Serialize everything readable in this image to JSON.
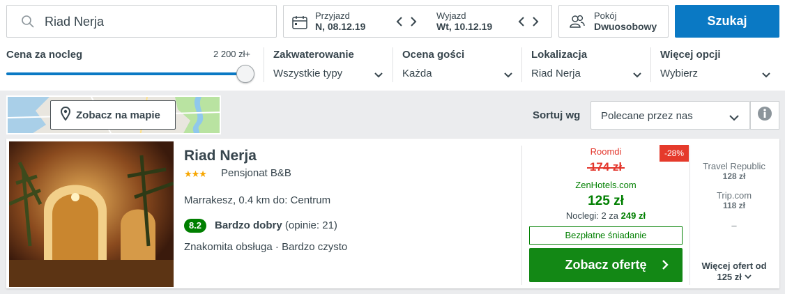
{
  "search": {
    "query": "Riad Nerja"
  },
  "dates": {
    "checkin_label": "Przyjazd",
    "checkin_value": "N, 08.12.19",
    "checkout_label": "Wyjazd",
    "checkout_value": "Wt, 10.12.19"
  },
  "room": {
    "label": "Pokój",
    "value": "Dwuosobowy"
  },
  "search_button": "Szukaj",
  "filters": {
    "price_label": "Cena za nocleg",
    "price_max": "2 200 zł+",
    "price_slider_fraction": 1.0,
    "accommodation_label": "Zakwaterowanie",
    "accommodation_value": "Wszystkie typy",
    "rating_label": "Ocena gości",
    "rating_value": "Każda",
    "location_label": "Lokalizacja",
    "location_value": "Riad Nerja",
    "more_label": "Więcej opcji",
    "more_value": "Wybierz"
  },
  "map_button": "Zobacz na mapie",
  "sort": {
    "label": "Sortuj wg",
    "value": "Polecane przez nas"
  },
  "hotel": {
    "name": "Riad Nerja",
    "stars": 3,
    "stars_text": "★★★",
    "type": "Pensjonat B&B",
    "location": "Marrakesz, 0.4 km do: Centrum",
    "rating_score": "8.2",
    "rating_word": "Bardzo dobry",
    "rating_count": "(opinie: 21)",
    "features": "Znakomita obsługa · Bardzo czysto",
    "deal": {
      "provider_old": "Roomdi",
      "discount": "-28%",
      "old_price": "174 zł",
      "provider_new": "ZenHotels.com",
      "new_price": "125 zł",
      "nights_text": "Noclegi: 2 za",
      "nights_total": "249 zł",
      "free_breakfast": "Bezpłatne śniadanie",
      "cta": "Zobacz ofertę"
    },
    "alternatives": [
      {
        "provider": "Travel Republic",
        "price": "128 zł"
      },
      {
        "provider": "Trip.com",
        "price": "118 zł"
      },
      {
        "provider": "–",
        "price": ""
      }
    ],
    "more_offers_line1": "Więcej ofert od",
    "more_offers_line2": "125 zł"
  },
  "colors": {
    "primary": "#0a79c4",
    "deal_green": "#138815",
    "discount_red": "#e53a2b",
    "star": "#f7a600"
  }
}
